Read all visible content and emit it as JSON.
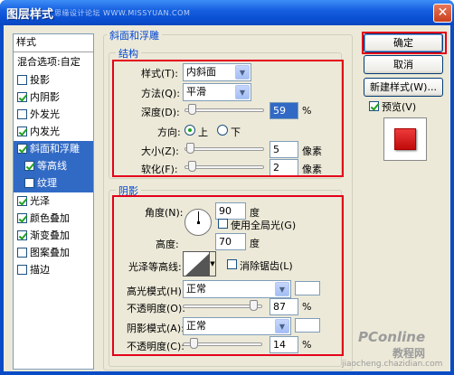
{
  "window": {
    "title": "图层样式",
    "watermark_top": "思缘设计论坛 WWW.MISSYUAN.COM"
  },
  "left_list": {
    "header": "样式",
    "blend_options": "混合选项:自定",
    "items": [
      {
        "label": "投影",
        "checked": false
      },
      {
        "label": "内阴影",
        "checked": true
      },
      {
        "label": "外发光",
        "checked": false
      },
      {
        "label": "内发光",
        "checked": true
      },
      {
        "label": "斜面和浮雕",
        "checked": true,
        "selected": true
      },
      {
        "label": "等高线",
        "checked": true,
        "sub": true
      },
      {
        "label": "纹理",
        "checked": false,
        "sub": true
      },
      {
        "label": "光泽",
        "checked": true
      },
      {
        "label": "颜色叠加",
        "checked": true
      },
      {
        "label": "渐变叠加",
        "checked": true
      },
      {
        "label": "图案叠加",
        "checked": false
      },
      {
        "label": "描边",
        "checked": false
      }
    ]
  },
  "bevel": {
    "section_title": "斜面和浮雕",
    "structure_title": "结构",
    "style_label": "样式(T):",
    "style_value": "内斜面",
    "method_label": "方法(Q):",
    "method_value": "平滑",
    "depth_label": "深度(D):",
    "depth_value": "59",
    "depth_unit": "%",
    "direction_label": "方向:",
    "dir_up": "上",
    "dir_down": "下",
    "size_label": "大小(Z):",
    "size_value": "5",
    "size_unit": "像素",
    "soften_label": "软化(F):",
    "soften_value": "2",
    "soften_unit": "像素"
  },
  "shading": {
    "title": "阴影",
    "angle_label": "角度(N):",
    "angle_value": "90",
    "angle_unit": "度",
    "global_light_label": "使用全局光(G)",
    "altitude_label": "高度:",
    "altitude_value": "70",
    "altitude_unit": "度",
    "gloss_label": "光泽等高线:",
    "antialias_label": "消除锯齿(L)",
    "highlight_mode_label": "高光模式(H):",
    "highlight_mode_value": "正常",
    "highlight_opacity_label": "不透明度(O):",
    "highlight_opacity_value": "87",
    "pct": "%",
    "shadow_mode_label": "阴影模式(A):",
    "shadow_mode_value": "正常",
    "shadow_opacity_label": "不透明度(C):",
    "shadow_opacity_value": "14"
  },
  "buttons": {
    "ok": "确定",
    "cancel": "取消",
    "new_style": "新建样式(W)...",
    "preview": "预览(V)"
  },
  "watermark_bottom": {
    "line1": "PConline",
    "line2": "教程网",
    "line3": "jiaocheng.chazidian.com"
  },
  "colors": {
    "accent": "#0046d5",
    "highlight_box": "#e3001b",
    "selection": "#316ac5",
    "preview_fill": "#d31414"
  }
}
